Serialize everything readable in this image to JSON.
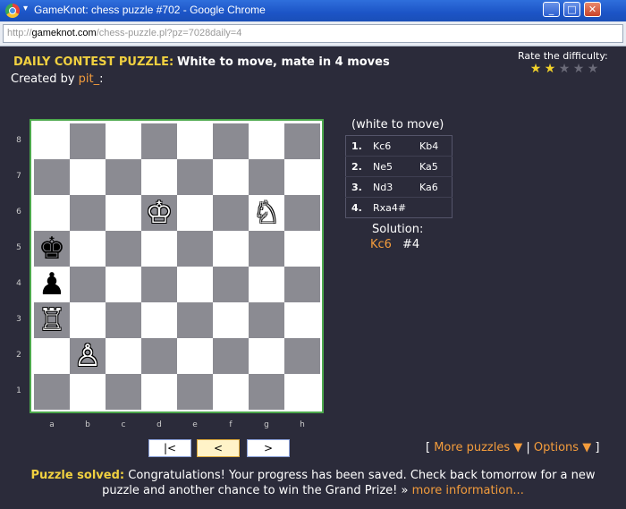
{
  "window": {
    "title": "GameKnot: chess puzzle #702 - Google Chrome",
    "minimize_icon": "_",
    "maximize_icon": "□",
    "close_icon": "✕"
  },
  "address_bar": {
    "scheme": "http://",
    "host": "gameknot.com",
    "path": "/chess-puzzle.pl?pz=7028daily=4"
  },
  "header": {
    "contest_label": "DAILY CONTEST PUZZLE:",
    "puzzle_title": "White to move, mate in 4 moves",
    "created_by_label": "Created by",
    "author": "pit_",
    "author_suffix": ":"
  },
  "rating": {
    "label": "Rate the difficulty:",
    "stars_total": 5,
    "stars_filled": 2
  },
  "board": {
    "ranks": [
      "8",
      "7",
      "6",
      "5",
      "4",
      "3",
      "2",
      "1"
    ],
    "files": [
      "a",
      "b",
      "c",
      "d",
      "e",
      "f",
      "g",
      "h"
    ],
    "pieces": [
      {
        "square": "d6",
        "glyph": "♔",
        "color": "white",
        "name": "white-king"
      },
      {
        "square": "g6",
        "glyph": "♘",
        "color": "white",
        "name": "white-knight"
      },
      {
        "square": "a5",
        "glyph": "♚",
        "color": "black",
        "name": "black-king"
      },
      {
        "square": "a4",
        "glyph": "♟",
        "color": "black",
        "name": "black-pawn"
      },
      {
        "square": "a3",
        "glyph": "♖",
        "color": "white",
        "name": "white-rook"
      },
      {
        "square": "b2",
        "glyph": "♙",
        "color": "white",
        "name": "white-pawn"
      }
    ]
  },
  "moves_panel": {
    "to_move": "(white to move)",
    "moves": [
      {
        "num": "1.",
        "white": "Kc6",
        "black": "Kb4"
      },
      {
        "num": "2.",
        "white": "Ne5",
        "black": "Ka5"
      },
      {
        "num": "3.",
        "white": "Nd3",
        "black": "Ka6"
      },
      {
        "num": "4.",
        "white": "Rxa4#",
        "black": ""
      }
    ],
    "solution_label": "Solution:",
    "solution_move": "Kc6",
    "solution_mate": "#4"
  },
  "nav": {
    "first": "|<",
    "prev": "<",
    "next": ">"
  },
  "links": {
    "open_bracket": "[",
    "more_puzzles": "More puzzles ▼",
    "separator": "|",
    "options": "Options ▼",
    "close_bracket": "]"
  },
  "footer": {
    "solved_label": "Puzzle solved:",
    "message_1": "Congratulations! Your progress has been saved. Check back tomorrow for a new",
    "message_2": "puzzle and another chance to win the Grand Prize! »",
    "more_info": "more information..."
  }
}
